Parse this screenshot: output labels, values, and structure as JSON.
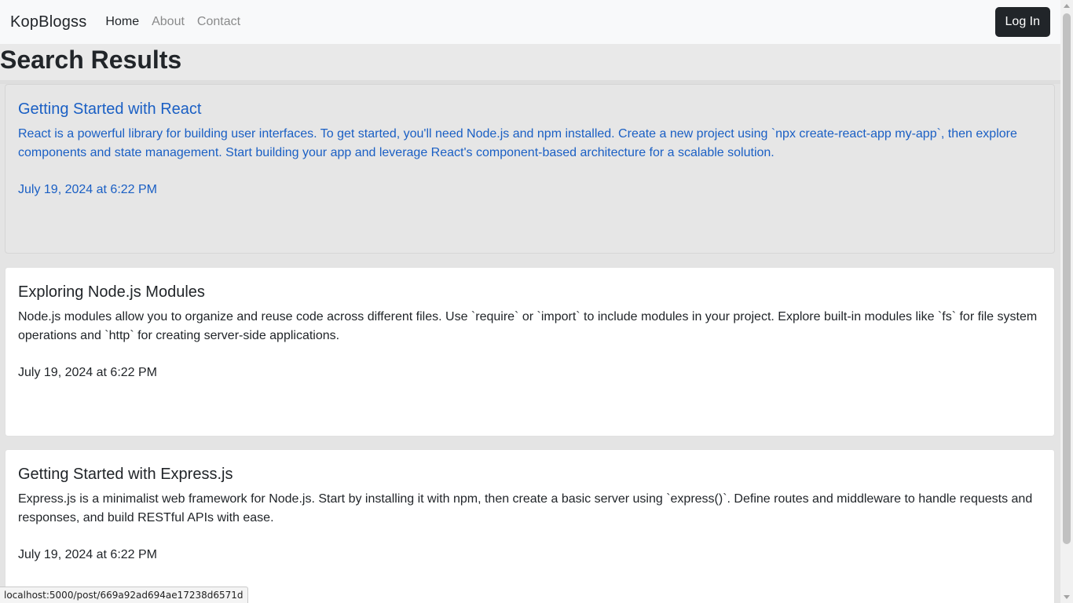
{
  "navbar": {
    "brand": "KopBlogss",
    "links": [
      {
        "label": "Home",
        "active": true
      },
      {
        "label": "About",
        "active": false
      },
      {
        "label": "Contact",
        "active": false
      }
    ],
    "login_label": "Log In"
  },
  "main": {
    "title": "Search Results",
    "posts": [
      {
        "title": "Getting Started with React",
        "body": "React is a powerful library for building user interfaces. To get started, you'll need Node.js and npm installed. Create a new project using `npx create-react-app my-app`, then explore components and state management. Start building your app and leverage React's component-based architecture for a scalable solution.",
        "date": "July 19, 2024 at 6:22 PM",
        "hovered": true
      },
      {
        "title": "Exploring Node.js Modules",
        "body": "Node.js modules allow you to organize and reuse code across different files. Use `require` or `import` to include modules in your project. Explore built-in modules like `fs` for file system operations and `http` for creating server-side applications.",
        "date": "July 19, 2024 at 6:22 PM",
        "hovered": false
      },
      {
        "title": "Getting Started with Express.js",
        "body": "Express.js is a minimalist web framework for Node.js. Start by installing it with npm, then create a basic server using `express()`. Define routes and middleware to handle requests and responses, and build RESTful APIs with ease.",
        "date": "July 19, 2024 at 6:22 PM",
        "hovered": false
      }
    ]
  },
  "status_bar": {
    "url": "localhost:5000/post/669a92ad694ae17238d6571d"
  },
  "colors": {
    "navbar_bg": "#f8f9fa",
    "login_bg": "#212529",
    "link_hover": "#1a5fc4",
    "page_bg": "#e9e9e9"
  }
}
